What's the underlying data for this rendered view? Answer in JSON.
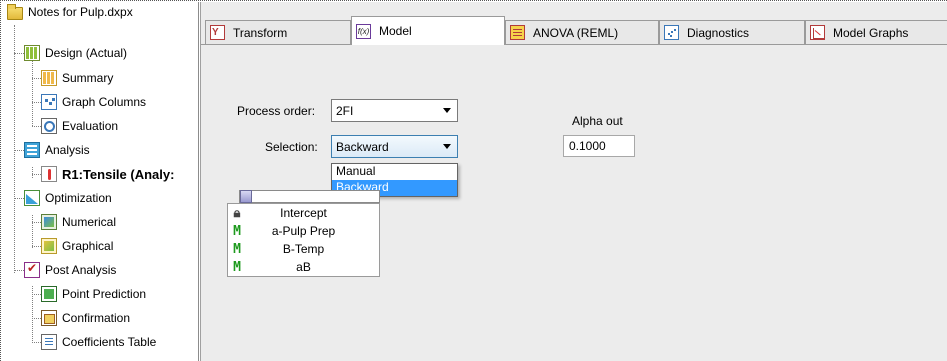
{
  "tree": {
    "root": "Notes for Pulp.dxpx",
    "items": [
      {
        "label": "Design (Actual)",
        "icon": "design-grid-icon"
      },
      {
        "label": "Summary",
        "icon": "summary-icon"
      },
      {
        "label": "Graph Columns",
        "icon": "graph-columns-icon"
      },
      {
        "label": "Evaluation",
        "icon": "evaluation-icon"
      },
      {
        "label": "Analysis",
        "icon": "analysis-icon"
      },
      {
        "label": "R1:Tensile (Analy:",
        "icon": "response-icon"
      },
      {
        "label": "Optimization",
        "icon": "optimization-icon"
      },
      {
        "label": "Numerical",
        "icon": "numerical-icon"
      },
      {
        "label": "Graphical",
        "icon": "graphical-icon"
      },
      {
        "label": "Post Analysis",
        "icon": "post-analysis-icon"
      },
      {
        "label": "Point Prediction",
        "icon": "point-prediction-icon"
      },
      {
        "label": "Confirmation",
        "icon": "confirmation-icon"
      },
      {
        "label": "Coefficients Table",
        "icon": "coefficients-table-icon"
      }
    ]
  },
  "tabs": [
    {
      "label": "Transform",
      "icon": "transform-icon",
      "active": false
    },
    {
      "label": "Model",
      "icon": "model-fx-icon",
      "icon_text": "f(x)",
      "active": true
    },
    {
      "label": "ANOVA (REML)",
      "icon": "anova-icon",
      "active": false
    },
    {
      "label": "Diagnostics",
      "icon": "diagnostics-icon",
      "active": false
    },
    {
      "label": "Model Graphs",
      "icon": "model-graphs-icon",
      "active": false
    }
  ],
  "model": {
    "process_order_label": "Process order:",
    "process_order_value": "2FI",
    "selection_label": "Selection:",
    "selection_value": "Backward",
    "selection_options": [
      "Manual",
      "Backward"
    ],
    "selection_highlighted": "Backward",
    "alpha_out_label": "Alpha out",
    "alpha_out_value": "0.1000",
    "terms": [
      {
        "name": "Intercept",
        "marker": "lock-icon"
      },
      {
        "name": "a-Pulp Prep",
        "marker": "M"
      },
      {
        "name": "B-Temp",
        "marker": "M"
      },
      {
        "name": "aB",
        "marker": "M"
      }
    ]
  },
  "colors": {
    "highlight": "#3399ff",
    "model_marker": "#1e9a1e",
    "panel_bg": "#ececec"
  }
}
